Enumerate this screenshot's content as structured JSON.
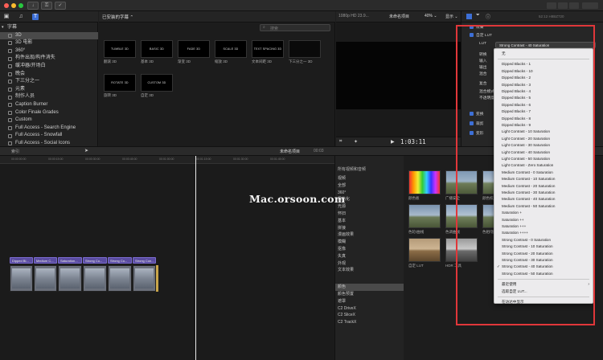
{
  "titlebar": {
    "colors": [
      "#ff5f57",
      "#febc2e",
      "#28c840"
    ]
  },
  "library": {
    "sidebar_items": [
      {
        "label": "字幕",
        "header": true
      },
      {
        "label": "3D",
        "selected": true
      },
      {
        "label": "3D 电影"
      },
      {
        "label": "360°"
      },
      {
        "label": "构件出现/构件消失"
      },
      {
        "label": "缓冲器/开场白"
      },
      {
        "label": "晚会"
      },
      {
        "label": "下三分之一"
      },
      {
        "label": "元素"
      },
      {
        "label": "制作人员"
      },
      {
        "label": "Caption Burner"
      },
      {
        "label": "Color Finale Grades"
      },
      {
        "label": "Custom"
      },
      {
        "label": "Full Access - Search Engine"
      },
      {
        "label": "Full Access - Snowfall"
      },
      {
        "label": "Full Access - Social Icons"
      }
    ]
  },
  "browser": {
    "header": "已安装的字幕 ⌃",
    "search_placeholder": "搜索",
    "thumbs": [
      {
        "inner": "TUMBLE 3D",
        "caption": "翻滚 3D"
      },
      {
        "inner": "BASIC 3D",
        "caption": "基本 3D"
      },
      {
        "inner": "FADE 3D",
        "caption": "渐变 3D"
      },
      {
        "inner": "SCALE 3D",
        "caption": "缩放 3D"
      },
      {
        "inner": "TEXT SPACING 3D",
        "caption": "文本间距 3D"
      },
      {
        "inner": "",
        "caption": "下三分之一 3D"
      },
      {
        "inner": "ROTATE 3D",
        "caption": "旋转 3D"
      },
      {
        "inner": "CUSTOM 3D",
        "caption": "自定 3D"
      }
    ]
  },
  "viewer": {
    "format": "1080p HD 23.9...",
    "project": "未命名项目",
    "zoom": "40% ⌄",
    "view_label": "显示 ⌄",
    "timecode": "1:03:11"
  },
  "inspector": {
    "top_tabs": "52:12 HIBIZ720",
    "rows": [
      {
        "label": "效果",
        "checked": true
      },
      {
        "label": "自定 LUT",
        "checked": true
      },
      {
        "label": "LUT",
        "checked": false
      },
      {
        "label": "转换",
        "checked": false
      },
      {
        "label": "输入",
        "checked": false
      },
      {
        "label": "输出",
        "checked": false
      },
      {
        "label": "混合",
        "checked": false
      },
      {
        "label": "复合",
        "checked": false
      },
      {
        "label": "混合模式",
        "checked": false
      },
      {
        "label": "不透明度",
        "checked": false
      },
      {
        "label": "变换",
        "checked": true
      },
      {
        "label": "裁剪",
        "checked": true
      },
      {
        "label": "变形",
        "checked": true
      }
    ],
    "popup_value": "Strong Contrast - 40 Saturation"
  },
  "lut_menu": {
    "items": [
      {
        "label": "无",
        "checked": false
      },
      {
        "sep": true
      },
      {
        "label": "Dipped Blacks - 1",
        "checked": false
      },
      {
        "label": "Dipped Blacks - 10",
        "checked": false
      },
      {
        "label": "Dipped Blacks - 2",
        "checked": false
      },
      {
        "label": "Dipped Blacks - 3",
        "checked": false
      },
      {
        "label": "Dipped Blacks - 4",
        "checked": false
      },
      {
        "label": "Dipped Blacks - 5",
        "checked": false
      },
      {
        "label": "Dipped Blacks - 6",
        "checked": false
      },
      {
        "label": "Dipped Blacks - 7",
        "checked": false
      },
      {
        "label": "Dipped Blacks - 8",
        "checked": false
      },
      {
        "label": "Dipped Blacks - 9",
        "checked": false
      },
      {
        "label": "Light Contrast - 10 Saturation",
        "checked": false
      },
      {
        "label": "Light Contrast - 20 Saturation",
        "checked": false
      },
      {
        "label": "Light Contrast - 30 Saturation",
        "checked": false
      },
      {
        "label": "Light Contrast - 40 Saturation",
        "checked": false
      },
      {
        "label": "Light Contrast - 50 Saturation",
        "checked": false
      },
      {
        "label": "Light Contrast - Zero Saturation",
        "checked": false
      },
      {
        "label": "Medium Contrast - 0 Saturation",
        "checked": false
      },
      {
        "label": "Medium Contrast - 10 Saturation",
        "checked": false
      },
      {
        "label": "Medium Contrast - 20 Saturation",
        "checked": false
      },
      {
        "label": "Medium Contrast - 30 Saturation",
        "checked": false
      },
      {
        "label": "Medium Contrast - 40 Saturation",
        "checked": false
      },
      {
        "label": "Medium Contrast - 50 Saturation",
        "checked": false
      },
      {
        "label": "Saturation +",
        "checked": false
      },
      {
        "label": "Saturation ++",
        "checked": false
      },
      {
        "label": "Saturation +++",
        "checked": false
      },
      {
        "label": "Saturation ++++",
        "checked": false
      },
      {
        "label": "Strong Contrast - 0 Saturation",
        "checked": false
      },
      {
        "label": "Strong Contrast - 10 Saturation",
        "checked": false
      },
      {
        "label": "Strong Contrast - 20 Saturation",
        "checked": false
      },
      {
        "label": "Strong Contrast - 30 Saturation",
        "checked": false
      },
      {
        "label": "Strong Contrast - 40 Saturation",
        "checked": true
      },
      {
        "label": "Strong Contrast - 50 Saturation",
        "checked": false
      },
      {
        "sep": true
      },
      {
        "label": "最近使用",
        "checked": false,
        "submenu": true
      },
      {
        "label": "选取自定 LUT...",
        "checked": false
      },
      {
        "sep": true
      },
      {
        "label": "在访达中显示",
        "checked": false
      }
    ]
  },
  "timeline": {
    "index_label": "索引",
    "project": "未命名项目",
    "duration": "00:03",
    "ruler": [
      "00:00:00:00",
      "00:00:15:00",
      "00:00:30:00",
      "00:00:45:00",
      "00:01:00:00",
      "00:01:15:00",
      "00:01:30:00",
      "00:01:45:00"
    ],
    "title_clips": [
      "Dipped Bl...",
      "Medium C...",
      "Saturation...",
      "Strong Co...",
      "Strong Co...",
      "Strong Con..."
    ]
  },
  "effects": {
    "header": "所有视频和音频",
    "categories": [
      {
        "label": "视频"
      },
      {
        "label": "全部"
      },
      {
        "label": "360°"
      },
      {
        "label": "风格化"
      },
      {
        "label": "光源"
      },
      {
        "label": "怀旧"
      },
      {
        "label": "基本"
      },
      {
        "label": "拼接"
      },
      {
        "label": "漫画效果"
      },
      {
        "label": "模糊"
      },
      {
        "label": "抠像"
      },
      {
        "label": "失真"
      },
      {
        "label": "外观"
      },
      {
        "label": "文本效果"
      },
      {
        "label": "颜色",
        "selected": true
      },
      {
        "label": "颜色预置"
      },
      {
        "label": "遮罩"
      },
      {
        "label": "C2 DriveX"
      },
      {
        "label": "C2 SliceX"
      },
      {
        "label": "C2 TrackX"
      }
    ],
    "thumbs": [
      {
        "caption": "颜色板"
      },
      {
        "caption": "广播安全"
      },
      {
        "caption": "颜色校正"
      },
      {
        "caption": "色轮/曲线"
      },
      {
        "caption": "色调曲线"
      },
      {
        "caption": "色相/饱和度"
      },
      {
        "caption": "自定 LUT"
      },
      {
        "caption": "HDR 工具"
      }
    ]
  },
  "watermark": "Mac.orsoon.com"
}
